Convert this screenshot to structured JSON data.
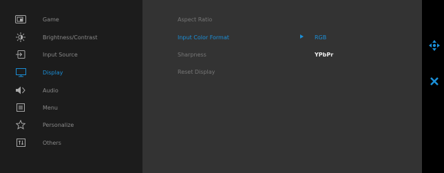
{
  "menu": {
    "items": [
      {
        "label": "Game",
        "icon": "game-icon"
      },
      {
        "label": "Brightness/Contrast",
        "icon": "brightness-icon"
      },
      {
        "label": "Input Source",
        "icon": "input-source-icon"
      },
      {
        "label": "Display",
        "icon": "display-icon",
        "active": true
      },
      {
        "label": "Audio",
        "icon": "speaker-icon"
      },
      {
        "label": "Menu",
        "icon": "menu-icon"
      },
      {
        "label": "Personalize",
        "icon": "star-icon"
      },
      {
        "label": "Others",
        "icon": "others-icon"
      }
    ]
  },
  "display": {
    "rows": [
      {
        "label": "Aspect Ratio"
      },
      {
        "label": "Input Color Format",
        "active": true
      },
      {
        "label": "Sharpness"
      },
      {
        "label": "Reset Display"
      }
    ],
    "options": [
      "RGB",
      "YPbPr"
    ],
    "selected_option": "RGB"
  },
  "controls": {
    "navigate_icon": "navigate-icon",
    "close_icon": "close-icon"
  },
  "colors": {
    "accent": "#1b8fd8",
    "sidebar_bg": "#1c1c1c",
    "content_bg": "#333333",
    "text_muted": "#8a8a8a"
  }
}
